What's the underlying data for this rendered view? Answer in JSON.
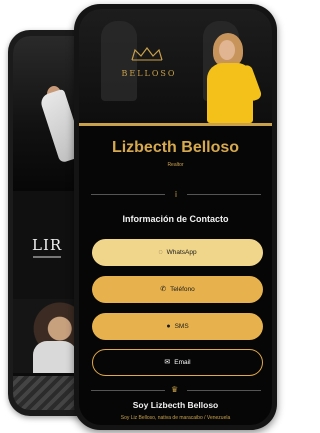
{
  "back_phone": {
    "logo_text": "LIR"
  },
  "profile": {
    "brand_name": "BELLOSO",
    "name": "Lizbecth Belloso",
    "role": "Realtor"
  },
  "contact": {
    "section_title": "Información de Contacto",
    "buttons": [
      {
        "id": "whatsapp",
        "label": "WhatsApp",
        "icon": "whatsapp-icon",
        "glyph": "◌"
      },
      {
        "id": "telefono",
        "label": "Teléfono",
        "icon": "phone-icon",
        "glyph": "✆"
      },
      {
        "id": "sms",
        "label": "SMS",
        "icon": "chat-icon",
        "glyph": "●"
      },
      {
        "id": "email",
        "label": "Email",
        "icon": "envelope-icon",
        "glyph": "✉"
      }
    ]
  },
  "about": {
    "title": "Soy Lizbecth Belloso",
    "text": "Soy Liz Belloso, nativa de maracaibo / Venezuela"
  },
  "colors": {
    "gold": "#c9a14a",
    "gold_light": "#f0d68a",
    "gold_button": "#e7b24d",
    "background": "#060606"
  }
}
